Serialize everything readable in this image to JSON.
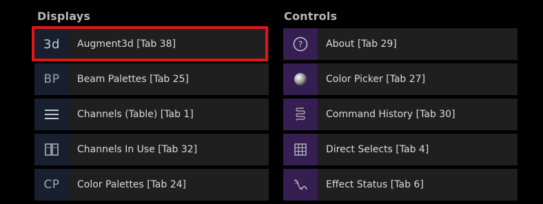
{
  "displays": {
    "title": "Displays",
    "items": [
      {
        "icon_text": "3d",
        "icon_name": "augment3d-icon",
        "label": "Augment3d [Tab 38]"
      },
      {
        "icon_text": "BP",
        "icon_name": "beam-palettes-icon",
        "label": "Beam Palettes [Tab 25]"
      },
      {
        "icon_name": "list-lines-icon",
        "label": "Channels (Table) [Tab 1]"
      },
      {
        "icon_name": "split-panel-icon",
        "label": "Channels In Use [Tab 32]"
      },
      {
        "icon_text": "CP",
        "icon_name": "color-palettes-icon",
        "label": "Color Palettes [Tab 24]"
      }
    ]
  },
  "controls": {
    "title": "Controls",
    "items": [
      {
        "icon_name": "question-circle-icon",
        "label": "About [Tab 29]"
      },
      {
        "icon_name": "color-sphere-icon",
        "label": "Color Picker [Tab 27]"
      },
      {
        "icon_name": "scroll-icon",
        "label": "Command History [Tab 30]"
      },
      {
        "icon_name": "grid-select-icon",
        "label": "Direct Selects [Tab 4]"
      },
      {
        "icon_name": "effect-wave-icon",
        "label": "Effect Status [Tab 6]"
      }
    ]
  },
  "highlight": {
    "target": "Augment3d [Tab 38]",
    "color": "#e4141b"
  },
  "colors": {
    "background": "#000000",
    "tile": "#1f1f1f",
    "display_icon_bg": "#182030",
    "control_icon_bg": "#351e52",
    "text": "#dcdcdc",
    "section_title": "#b8b8b8"
  }
}
